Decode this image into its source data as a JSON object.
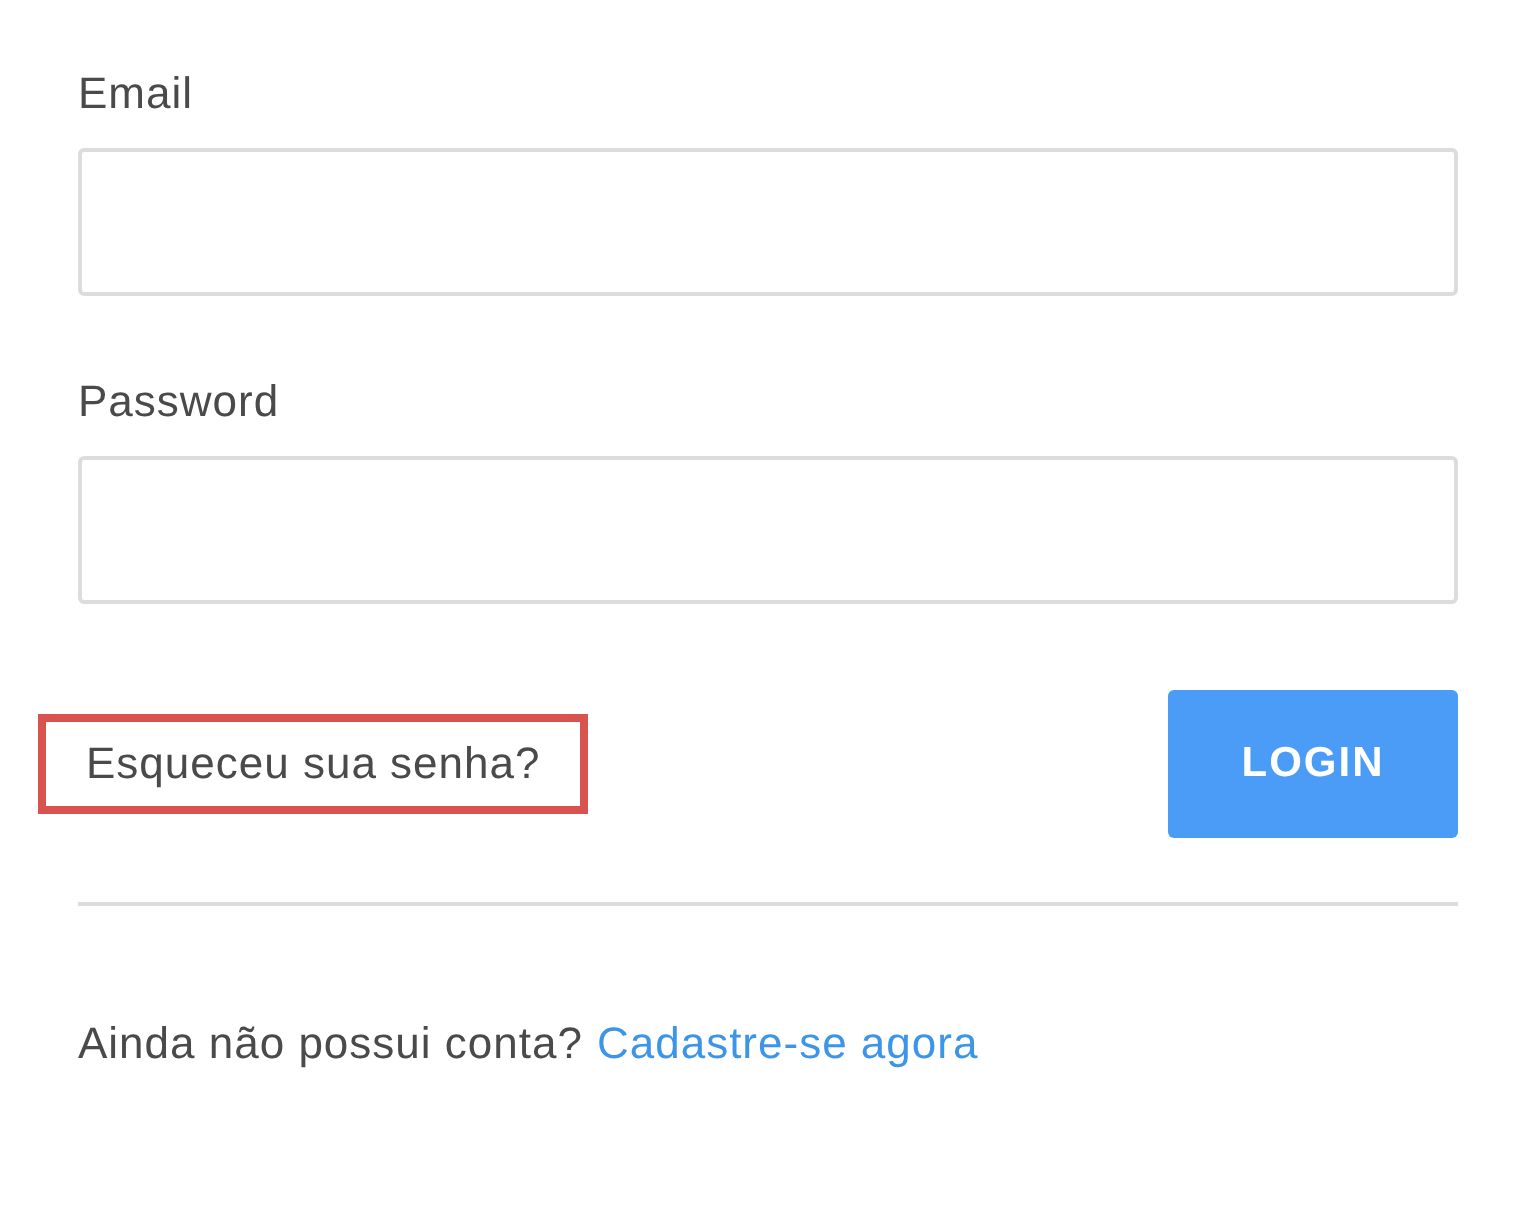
{
  "email": {
    "label": "Email"
  },
  "password": {
    "label": "Password"
  },
  "forgot_link": {
    "text": "Esqueceu sua senha?",
    "highlighted": true
  },
  "login_button": {
    "label": "LOGIN"
  },
  "signup": {
    "prompt": "Ainda não possui conta?",
    "link": "Cadastre-se agora"
  }
}
